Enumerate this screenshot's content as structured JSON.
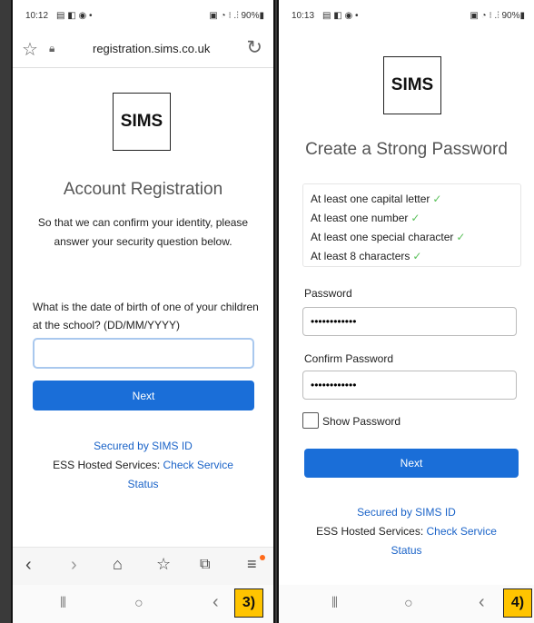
{
  "left": {
    "status_time": "10:12",
    "status_icons": "▤ ◧ ◉ •",
    "status_right": "▣ ◔ ⁝ .⫶ 90%▮",
    "url": "registration.sims.co.uk",
    "logo": "SIMS",
    "title": "Account Registration",
    "intro": "So that we can confirm your identity, please answer your security question below.",
    "question": "What is the date of birth of one of your children at the school? (DD/MM/YYYY)",
    "dob_value": "",
    "next_label": "Next",
    "footer_secured": "Secured by SIMS ID",
    "footer_ess": "ESS Hosted Services: ",
    "footer_check": "Check Service",
    "footer_status": "Status",
    "step": "3)"
  },
  "right": {
    "status_time": "10:13",
    "status_icons": "▤ ◧ ◉ •",
    "status_right": "▣ ◔ ⁝ .⫶ 90%▮",
    "logo": "SIMS",
    "title": "Create a Strong Password",
    "requirements": [
      "At least one capital letter",
      "At least one number",
      "At least one special character",
      "At least 8 characters"
    ],
    "password_label": "Password",
    "password_value": "••••••••••••",
    "confirm_label": "Confirm Password",
    "confirm_value": "••••••••••••",
    "show_password_label": "Show Password",
    "next_label": "Next",
    "footer_secured": "Secured by SIMS ID",
    "footer_ess": "ESS Hosted Services: ",
    "footer_check": "Check Service",
    "footer_status": "Status",
    "step": "4)"
  },
  "colors": {
    "accent": "#1a6ed8",
    "link": "#1a63c8",
    "check": "#5cc15c",
    "badge": "#ffc400"
  }
}
